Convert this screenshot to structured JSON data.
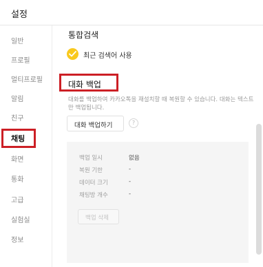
{
  "window": {
    "title": "설정"
  },
  "sidebar": {
    "items": [
      {
        "label": "일반"
      },
      {
        "label": "프로필"
      },
      {
        "label": "멀티프로필"
      },
      {
        "label": "알림"
      },
      {
        "label": "친구"
      },
      {
        "label": "채팅",
        "active": true
      },
      {
        "label": "화면"
      },
      {
        "label": "통화"
      },
      {
        "label": "고급"
      },
      {
        "label": "실험실"
      },
      {
        "label": "정보"
      }
    ]
  },
  "main": {
    "search_section": {
      "title": "통합검색",
      "recent_search_label": "최근 검색어 사용",
      "recent_search_checked": true
    },
    "backup_section": {
      "title": "대화 백업",
      "description": "대화를 백업하여 카카오톡을 재설치할 때 복원할 수 있습니다. 대화는 텍스트만 백업됩니다.",
      "backup_button": "대화 백업하기",
      "help_icon": "?",
      "info": [
        {
          "key": "백업 일시",
          "value": "없음"
        },
        {
          "key": "복원 기한",
          "value": "-"
        },
        {
          "key": "데이터 크기",
          "value": "-"
        },
        {
          "key": "채팅방 개수",
          "value": "-"
        }
      ],
      "delete_button": "백업 삭제"
    }
  },
  "colors": {
    "highlight": "#cc1f25",
    "check_accent": "#f9c91e"
  }
}
